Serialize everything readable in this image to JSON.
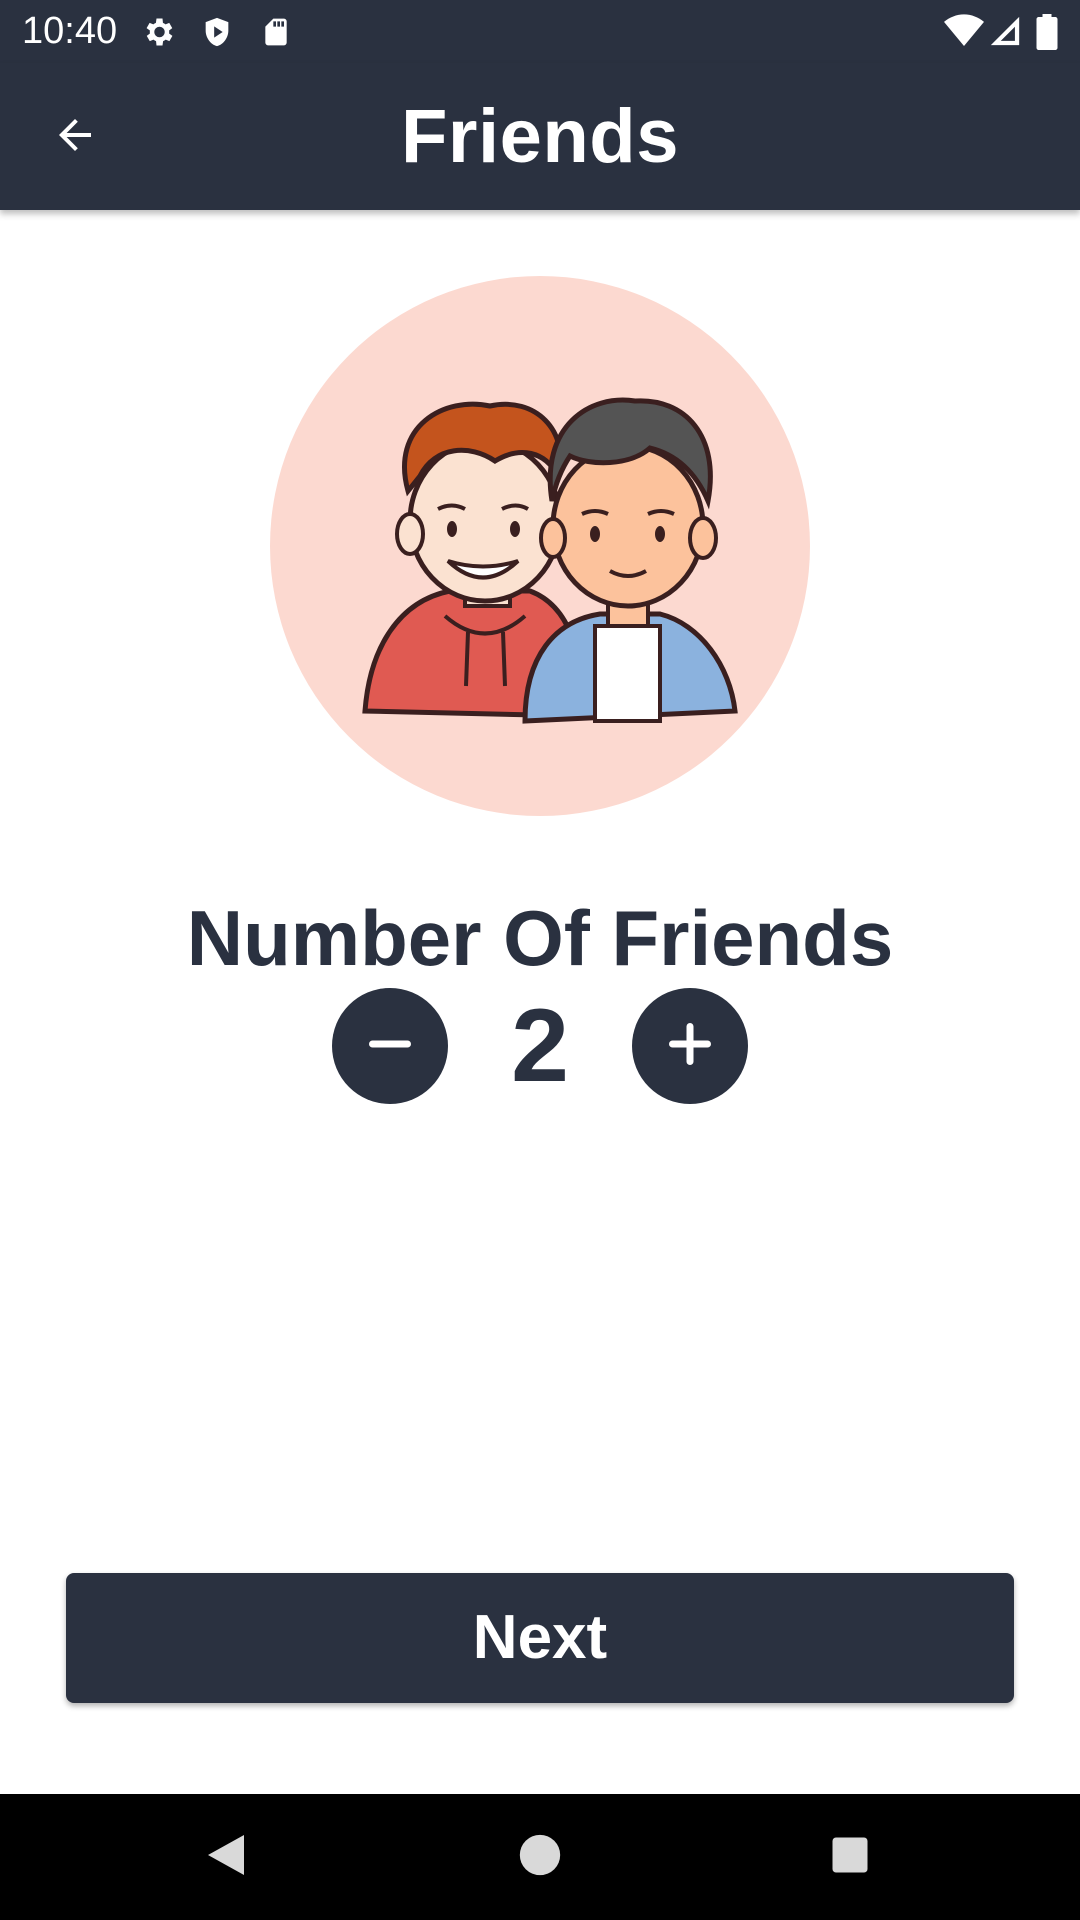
{
  "status_bar": {
    "time": "10:40",
    "left_icons": [
      "gear-icon",
      "shield-icon",
      "sd-card-icon"
    ],
    "right_icons": [
      "wifi-icon",
      "signal-icon",
      "battery-icon"
    ]
  },
  "app_bar": {
    "title": "Friends",
    "back_icon": "arrow-left-icon"
  },
  "illustration": {
    "description_icon": "two-friends-illustration",
    "background_color": "#fcd9d0"
  },
  "counter": {
    "label": "Number Of Friends",
    "value": "2",
    "decrement_icon": "minus-icon",
    "increment_icon": "plus-icon"
  },
  "actions": {
    "next_label": "Next"
  },
  "nav_bar": {
    "icons": [
      "back-triangle-icon",
      "home-circle-icon",
      "recents-square-icon"
    ]
  },
  "colors": {
    "primary_dark": "#2a3140",
    "background": "#ffffff",
    "illustration_bg": "#fcd9d0"
  }
}
